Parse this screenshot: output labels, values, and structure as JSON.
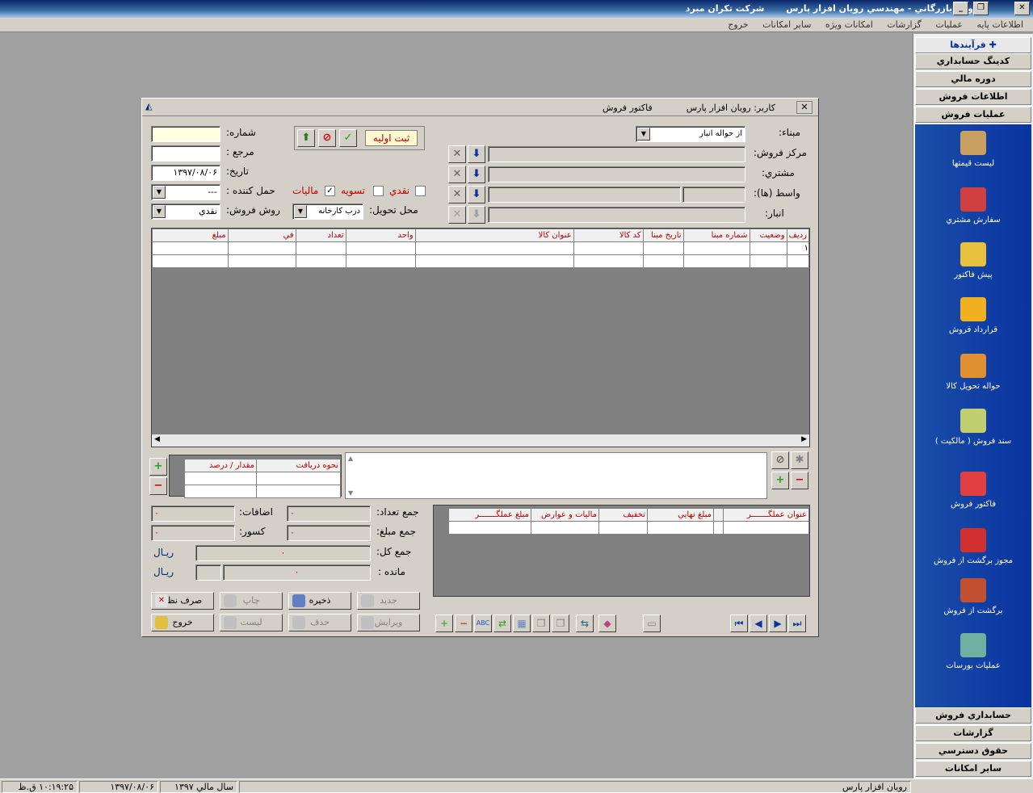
{
  "window": {
    "title": "فروش بازرگاني - مهندسي رويان افزار پارس",
    "company": "شركت تكران مبرد"
  },
  "menu": [
    "اطلاعات پايه",
    "عمليات",
    "گزارشات",
    "امكانات ويژه",
    "ساير امكانات",
    "خروج"
  ],
  "sidebar": {
    "pin": "فرآيندها",
    "heads_top": [
      "كدينگ حسابداري",
      "دوره مالي",
      "اطلاعات فروش",
      "عمليات فروش"
    ],
    "items": [
      "ليست قيمتها",
      "سفارش مشتري",
      "پيش فاكتور",
      "قرارداد فروش",
      "حواله تحويل كالا",
      "سند فروش ( مالكيت )",
      "فاكتور فروش",
      "مجوز برگشت از فروش",
      "برگشت از فروش",
      "عمليات بورسات"
    ],
    "heads_bottom": [
      "حسابداري فروش",
      "گزارشات",
      "حقوق دسترسي",
      "ساير امكانات"
    ]
  },
  "dialog": {
    "title": "فاكتور فروش",
    "user_label": "كاربر:",
    "user": "رويان افزار پارس",
    "labels": {
      "number": "شماره:",
      "ref": "مرجع :",
      "date": "تاريخ:",
      "carrier": "حمل كننده :",
      "sale_method": "روش فروش:",
      "delivery": "محل تحويل:",
      "base": "مبناء:",
      "sales_center": "مركز فروش:",
      "customer": "مشتري:",
      "broker": "واسط (ها):",
      "warehouse": "انبار:"
    },
    "values": {
      "date": "۱۳۹۷/۰۸/۰۶",
      "carrier": "---",
      "sale_method": "نقدي",
      "delivery": "درب كارخانه",
      "base": "از حواله انبار"
    },
    "status_button": "ثبت اوليه",
    "checks": {
      "cash": "نقدي",
      "settle": "تسويه",
      "tax": "ماليات"
    },
    "grid_headers": [
      "رديف",
      "وضعيت",
      "شماره مبنا",
      "تاريخ مبنا",
      "كد كالا",
      "عنوان كالا",
      "واحد",
      "تعداد",
      "في",
      "مبلغ"
    ],
    "row1": "۱",
    "receipt_headers": [
      "نحوه دريافت",
      "مقدار / درصد"
    ],
    "totals": {
      "count_label": "جمع تعداد:",
      "amount_label": "جمع مبلغ:",
      "total_label": "جمع كل:",
      "remain_label": "مانده :",
      "add_label": "اضافات:",
      "ded_label": "كسور:",
      "zero": "۰",
      "rial": "ريـال"
    },
    "agent_headers": [
      "عنوان عملگـــــــر",
      "مبلغ نهايي",
      "تخفيف",
      "ماليات و عوارض",
      "مبلغ عملگـــــــر"
    ],
    "buttons": {
      "new": "جديد",
      "save": "ذخيره",
      "print": "چاپ",
      "cancel": "صرف نظر",
      "edit": "ويرايش",
      "delete": "حذف",
      "list": "ليست",
      "exit": "خروج"
    }
  },
  "status": {
    "user": "رويان افزار پارس",
    "fy": "سال مالي ۱۳۹۷",
    "date": "۱۳۹۷/۰۸/۰۶",
    "time": "۱۰:۱۹:۲۵ ق.ظ"
  },
  "colors": {
    "accent": "#0a33a0",
    "red_header": "#c00000"
  }
}
